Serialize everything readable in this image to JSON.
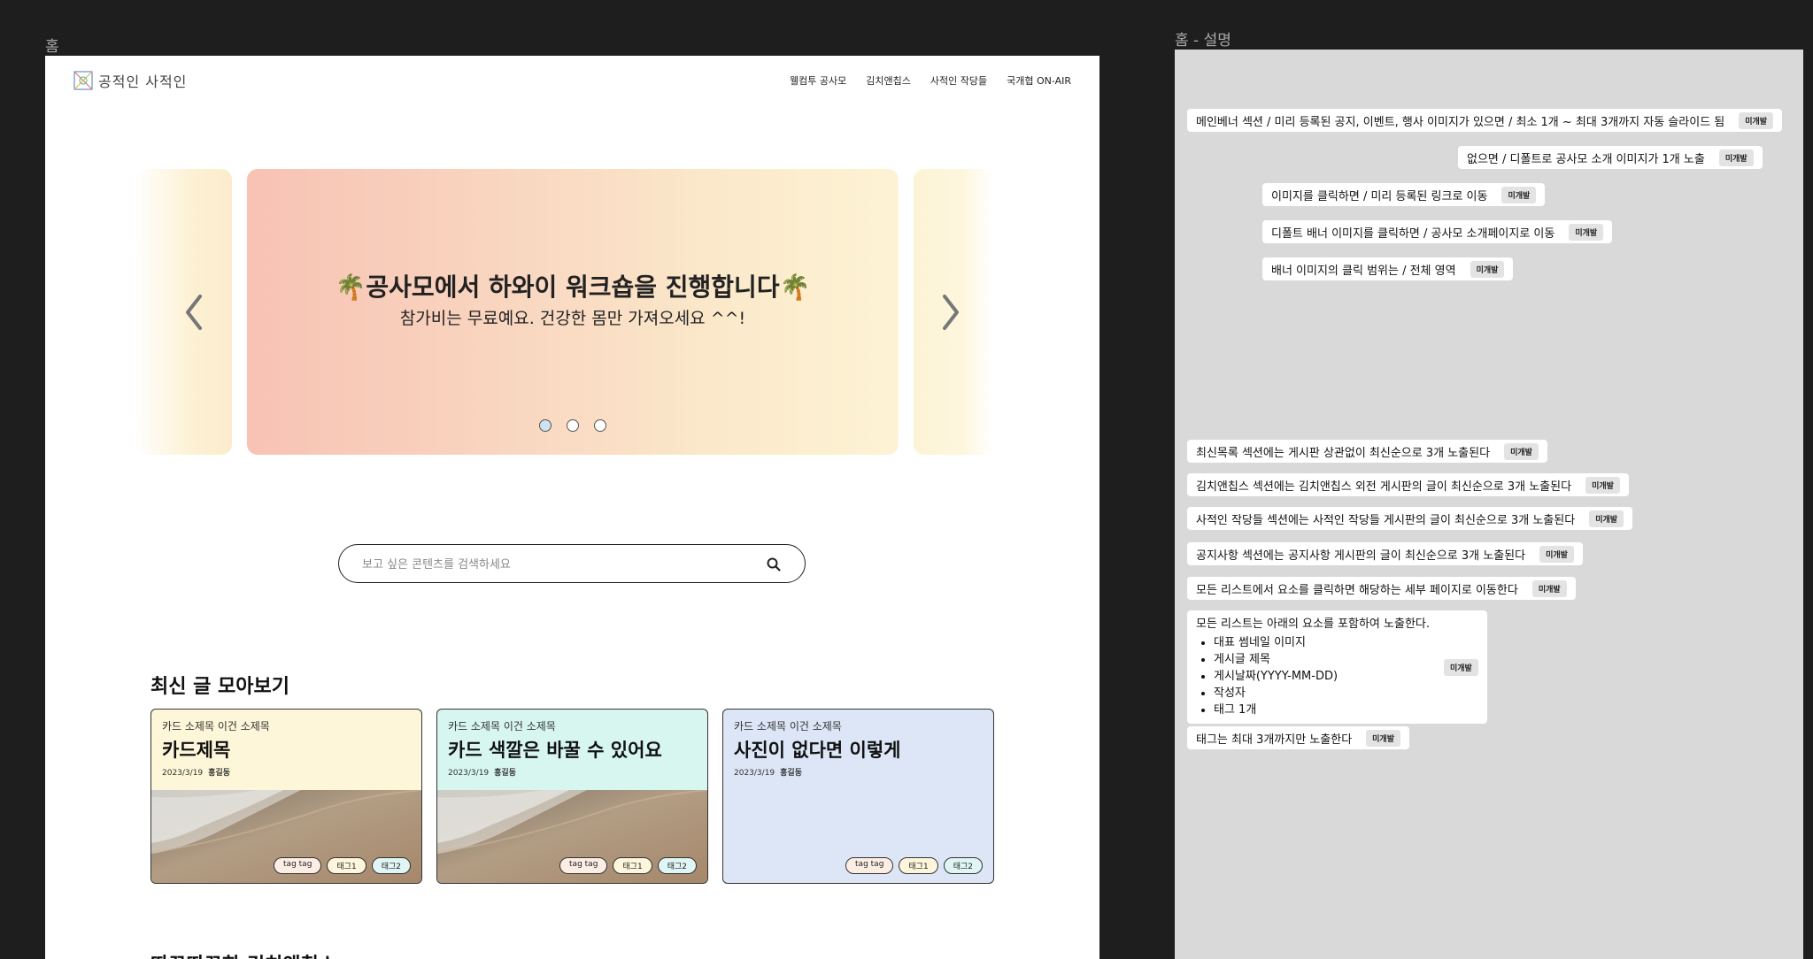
{
  "frames": {
    "home_label": "홈",
    "desc_label": "홈 - 설명"
  },
  "header": {
    "logo_text": "공적인 사적인",
    "nav": [
      "웰컴투 공사모",
      "김치앤칩스",
      "사적인 작당들",
      "국개협 ON-AIR"
    ]
  },
  "banner": {
    "title": "🌴공사모에서 하와이 워크숍을 진행합니다🌴",
    "subtitle": "참가비는 무료예요. 건강한 몸만 가져오세요 ^^!",
    "total_slides": 3,
    "active_slide": 1
  },
  "search": {
    "placeholder": "보고 싶은 콘텐츠를 검색하세요"
  },
  "latest": {
    "title": "최신 글 모아보기",
    "cards": [
      {
        "subtitle": "카드 소제목 이건 소제목",
        "title": "카드제목",
        "date": "2023/3/19",
        "author": "홍길동",
        "bg": "#fdf6d8",
        "has_image": true,
        "tags": [
          "tag tag",
          "태그1",
          "태그2"
        ]
      },
      {
        "subtitle": "카드 소제목 이건 소제목",
        "title": "카드 색깔은 바꿀 수 있어요",
        "date": "2023/3/19",
        "author": "홍길동",
        "bg": "#d7f6f0",
        "has_image": true,
        "tags": [
          "tag tag",
          "태그1",
          "태그2"
        ]
      },
      {
        "subtitle": "카드 소제목 이건 소제목",
        "title": "사진이 없다면 이렇게",
        "date": "2023/3/19",
        "author": "홍길동",
        "bg": "#dde6f7",
        "has_image": false,
        "tags": [
          "tag tag",
          "태그1",
          "태그2"
        ]
      }
    ]
  },
  "next_section": {
    "title": "따끈따끈한 김치앤칩스"
  },
  "notes": {
    "badge": "미개발",
    "items": [
      "메인베너 섹션 /  미리 등록된 공지, 이벤트, 행사 이미지가 있으면 / 최소 1개 ~ 최대 3개까지 자동 슬라이드 됨",
      "없으면 / 디폴트로 공사모 소개  이미지가 1개 노출",
      "이미지를 클릭하면 / 미리 등록된 링크로 이동",
      "디폴트 배너 이미지를 클릭하면 / 공사모 소개페이지로 이동",
      "배너 이미지의 클릭 범위는 / 전체 영역",
      "최신목록 섹션에는 게시판 상관없이 최신순으로 3개 노출된다",
      "김치앤칩스 섹션에는 김치앤칩스 외전 게시판의 글이 최신순으로 3개 노출된다",
      "사적인 작당들 섹션에는 사적인 작당들 게시판의 글이 최신순으로 3개 노출된다",
      "공지사항 섹션에는 공지사항 게시판의 글이 최신순으로 3개 노출된다",
      "모든 리스트에서 요소를 클릭하면 해당하는 세부 페이지로 이동한다"
    ],
    "list_note": {
      "lead": "모든 리스트는 아래의 요소를 포함하여 노출한다.",
      "bullets": [
        "대표 썸네일 이미지",
        "게시글 제목",
        "게시날짜(YYYY-MM-DD)",
        "작성자",
        "태그 1개"
      ]
    },
    "last_note": "태그는 최대 3개까지만 노출한다"
  }
}
